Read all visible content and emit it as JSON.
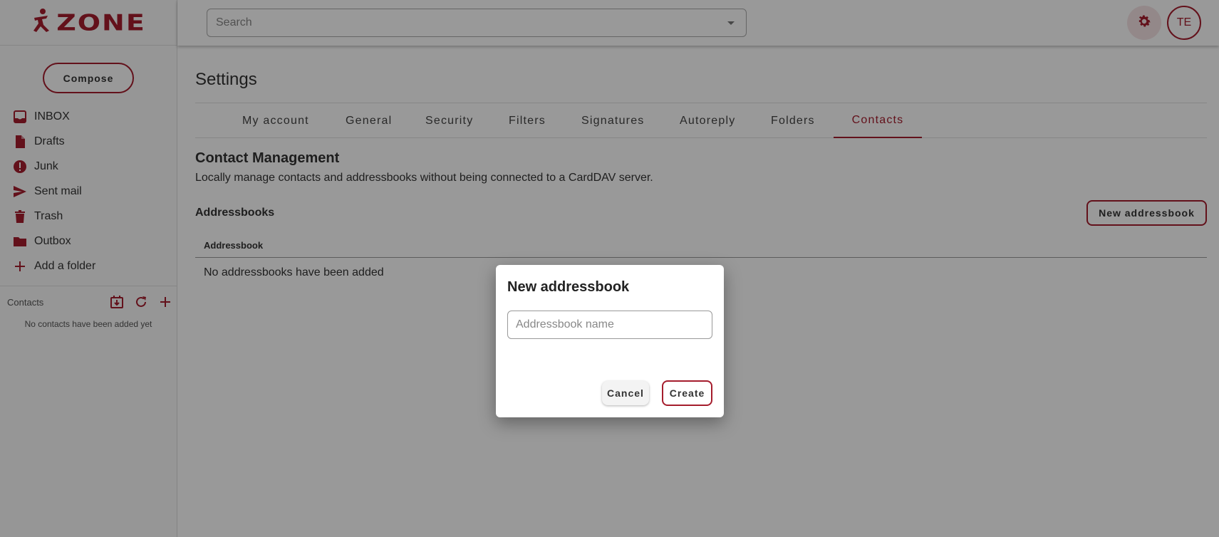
{
  "app": {
    "logo_text": "ZONE",
    "brand_color": "#a51d2d"
  },
  "sidebar": {
    "compose_label": "Compose",
    "folders": [
      {
        "label": "INBOX",
        "icon": "inbox-icon"
      },
      {
        "label": "Drafts",
        "icon": "draft-icon"
      },
      {
        "label": "Junk",
        "icon": "alert-icon"
      },
      {
        "label": "Sent mail",
        "icon": "send-icon"
      },
      {
        "label": "Trash",
        "icon": "trash-icon"
      },
      {
        "label": "Outbox",
        "icon": "folder-icon"
      },
      {
        "label": "Add a folder",
        "icon": "plus-icon"
      }
    ],
    "contacts_label": "Contacts",
    "no_contacts": "No contacts have been added yet"
  },
  "header": {
    "search_placeholder": "Search",
    "avatar_initials": "TE"
  },
  "settings": {
    "title": "Settings",
    "tabs": [
      {
        "label": "My account"
      },
      {
        "label": "General"
      },
      {
        "label": "Security"
      },
      {
        "label": "Filters"
      },
      {
        "label": "Signatures"
      },
      {
        "label": "Autoreply"
      },
      {
        "label": "Folders"
      },
      {
        "label": "Contacts",
        "active": true
      }
    ],
    "section_title": "Contact Management",
    "section_desc": "Locally manage contacts and addressbooks without being connected to a CardDAV server.",
    "addressbooks_label": "Addressbooks",
    "new_addressbook_label": "New addressbook",
    "table_header": "Addressbook",
    "empty_text": "No addressbooks have been added"
  },
  "dialog": {
    "title": "New addressbook",
    "input_placeholder": "Addressbook name",
    "input_value": "",
    "cancel_label": "Cancel",
    "create_label": "Create"
  }
}
